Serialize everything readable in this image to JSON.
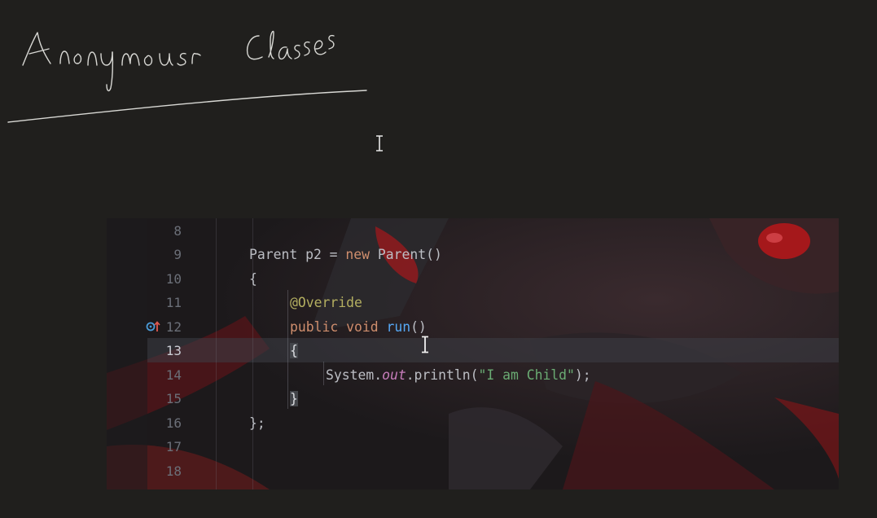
{
  "notes": {
    "heading": "Anonymous classes"
  },
  "editor": {
    "lines": [
      {
        "num": "8",
        "tokens": []
      },
      {
        "num": "9",
        "tokens": [
          {
            "t": "Parent p2 = ",
            "c": ""
          },
          {
            "t": "new",
            "c": "kw"
          },
          {
            "t": " Parent()",
            "c": ""
          }
        ]
      },
      {
        "num": "10",
        "tokens": [
          {
            "t": "{",
            "c": ""
          }
        ]
      },
      {
        "num": "11",
        "tokens": [
          {
            "t": "@Override",
            "c": "ann"
          }
        ]
      },
      {
        "num": "12",
        "tokens": [
          {
            "t": "public",
            "c": "kw"
          },
          {
            "t": " ",
            "c": ""
          },
          {
            "t": "void",
            "c": "kw"
          },
          {
            "t": " ",
            "c": ""
          },
          {
            "t": "run",
            "c": "fn"
          },
          {
            "t": "()",
            "c": ""
          }
        ]
      },
      {
        "num": "13",
        "tokens": [
          {
            "t": "{",
            "c": "brace-hl"
          }
        ]
      },
      {
        "num": "14",
        "tokens": [
          {
            "t": "System.",
            "c": ""
          },
          {
            "t": "out",
            "c": "fld"
          },
          {
            "t": ".println(",
            "c": ""
          },
          {
            "t": "\"I am Child\"",
            "c": "str"
          },
          {
            "t": ");",
            "c": ""
          }
        ]
      },
      {
        "num": "15",
        "tokens": [
          {
            "t": "}",
            "c": "brace-hl"
          }
        ]
      },
      {
        "num": "16",
        "tokens": [
          {
            "t": "};",
            "c": ""
          }
        ]
      },
      {
        "num": "17",
        "tokens": []
      },
      {
        "num": "18",
        "tokens": []
      }
    ]
  },
  "colors": {
    "background": "#201f1d",
    "keyword": "#cf8e6d",
    "annotation": "#b3ae60",
    "function": "#56a8f5",
    "string": "#6aab73",
    "field": "#c77dbb"
  },
  "icons": [
    "text-cursor-icon",
    "implements-method-icon"
  ]
}
